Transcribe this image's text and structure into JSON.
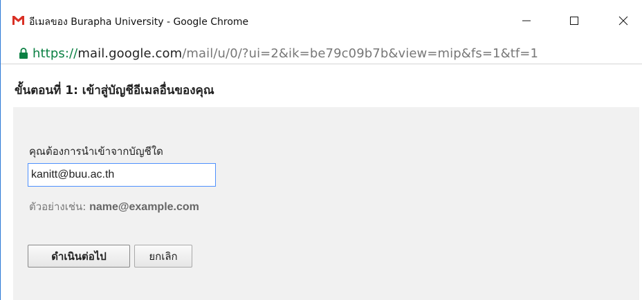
{
  "window": {
    "title": "อีเมลของ Burapha University - Google Chrome",
    "icon": "gmail-logo",
    "controls": [
      "minimize-icon",
      "maximize-icon",
      "close-icon"
    ]
  },
  "urlbar": {
    "scheme": "https://",
    "host": "mail.google.com",
    "path": "/mail/u/0/?ui=2&ik=be79c09b7b&view=mip&fs=1&tf=1"
  },
  "page": {
    "heading": "ขั้นตอนที่ 1: เข้าสู่บัญชีอีเมลอื่นของคุณ",
    "prompt": "คุณต้องการนำเข้าจากบัญชีใด",
    "email_value": "kanitt@buu.ac.th",
    "example_prefix": "ตัวอย่างเช่น:",
    "example_email": "name@example.com",
    "continue_label": "ดำเนินต่อไป",
    "cancel_label": "ยกเลิก"
  },
  "colors": {
    "url_scheme": "#0b8043",
    "input_focus_border": "#4d90fe",
    "panel_bg": "#f1f1f1"
  }
}
